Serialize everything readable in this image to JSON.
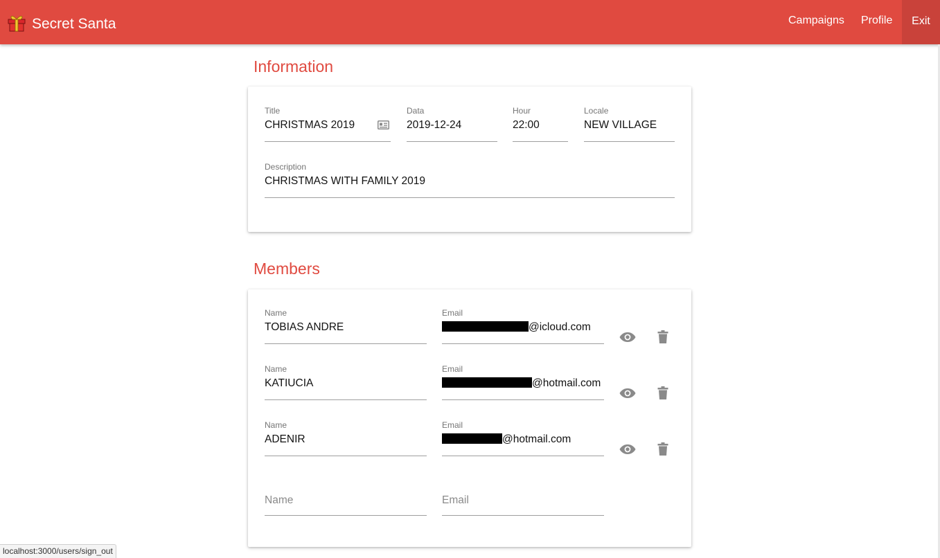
{
  "app": {
    "title": "Secret Santa",
    "brand_color": "#e04a40",
    "logo_icon": "gift-icon"
  },
  "nav": {
    "campaigns": "Campaigns",
    "profile": "Profile",
    "exit": "Exit"
  },
  "information": {
    "section_title": "Information",
    "title_label": "Title",
    "title_value": "CHRISTMAS 2019",
    "data_label": "Data",
    "data_value": "2019-12-24",
    "hour_label": "Hour",
    "hour_value": "22:00",
    "locale_label": "Locale",
    "locale_value": "NEW VILLAGE",
    "description_label": "Description",
    "description_value": "CHRISTMAS WITH FAMILY 2019"
  },
  "members": {
    "section_title": "Members",
    "name_label": "Name",
    "email_label": "Email",
    "rows": [
      {
        "name": "TOBIAS ANDRE",
        "email_domain": "@icloud.com"
      },
      {
        "name": "KATIUCIA",
        "email_domain": "@hotmail.com"
      },
      {
        "name": "ADENIR",
        "email_domain": "@hotmail.com"
      }
    ],
    "new_member": {
      "name_placeholder": "Name",
      "email_placeholder": "Email"
    }
  },
  "status_bar": {
    "url": "localhost:3000/users/sign_out"
  }
}
